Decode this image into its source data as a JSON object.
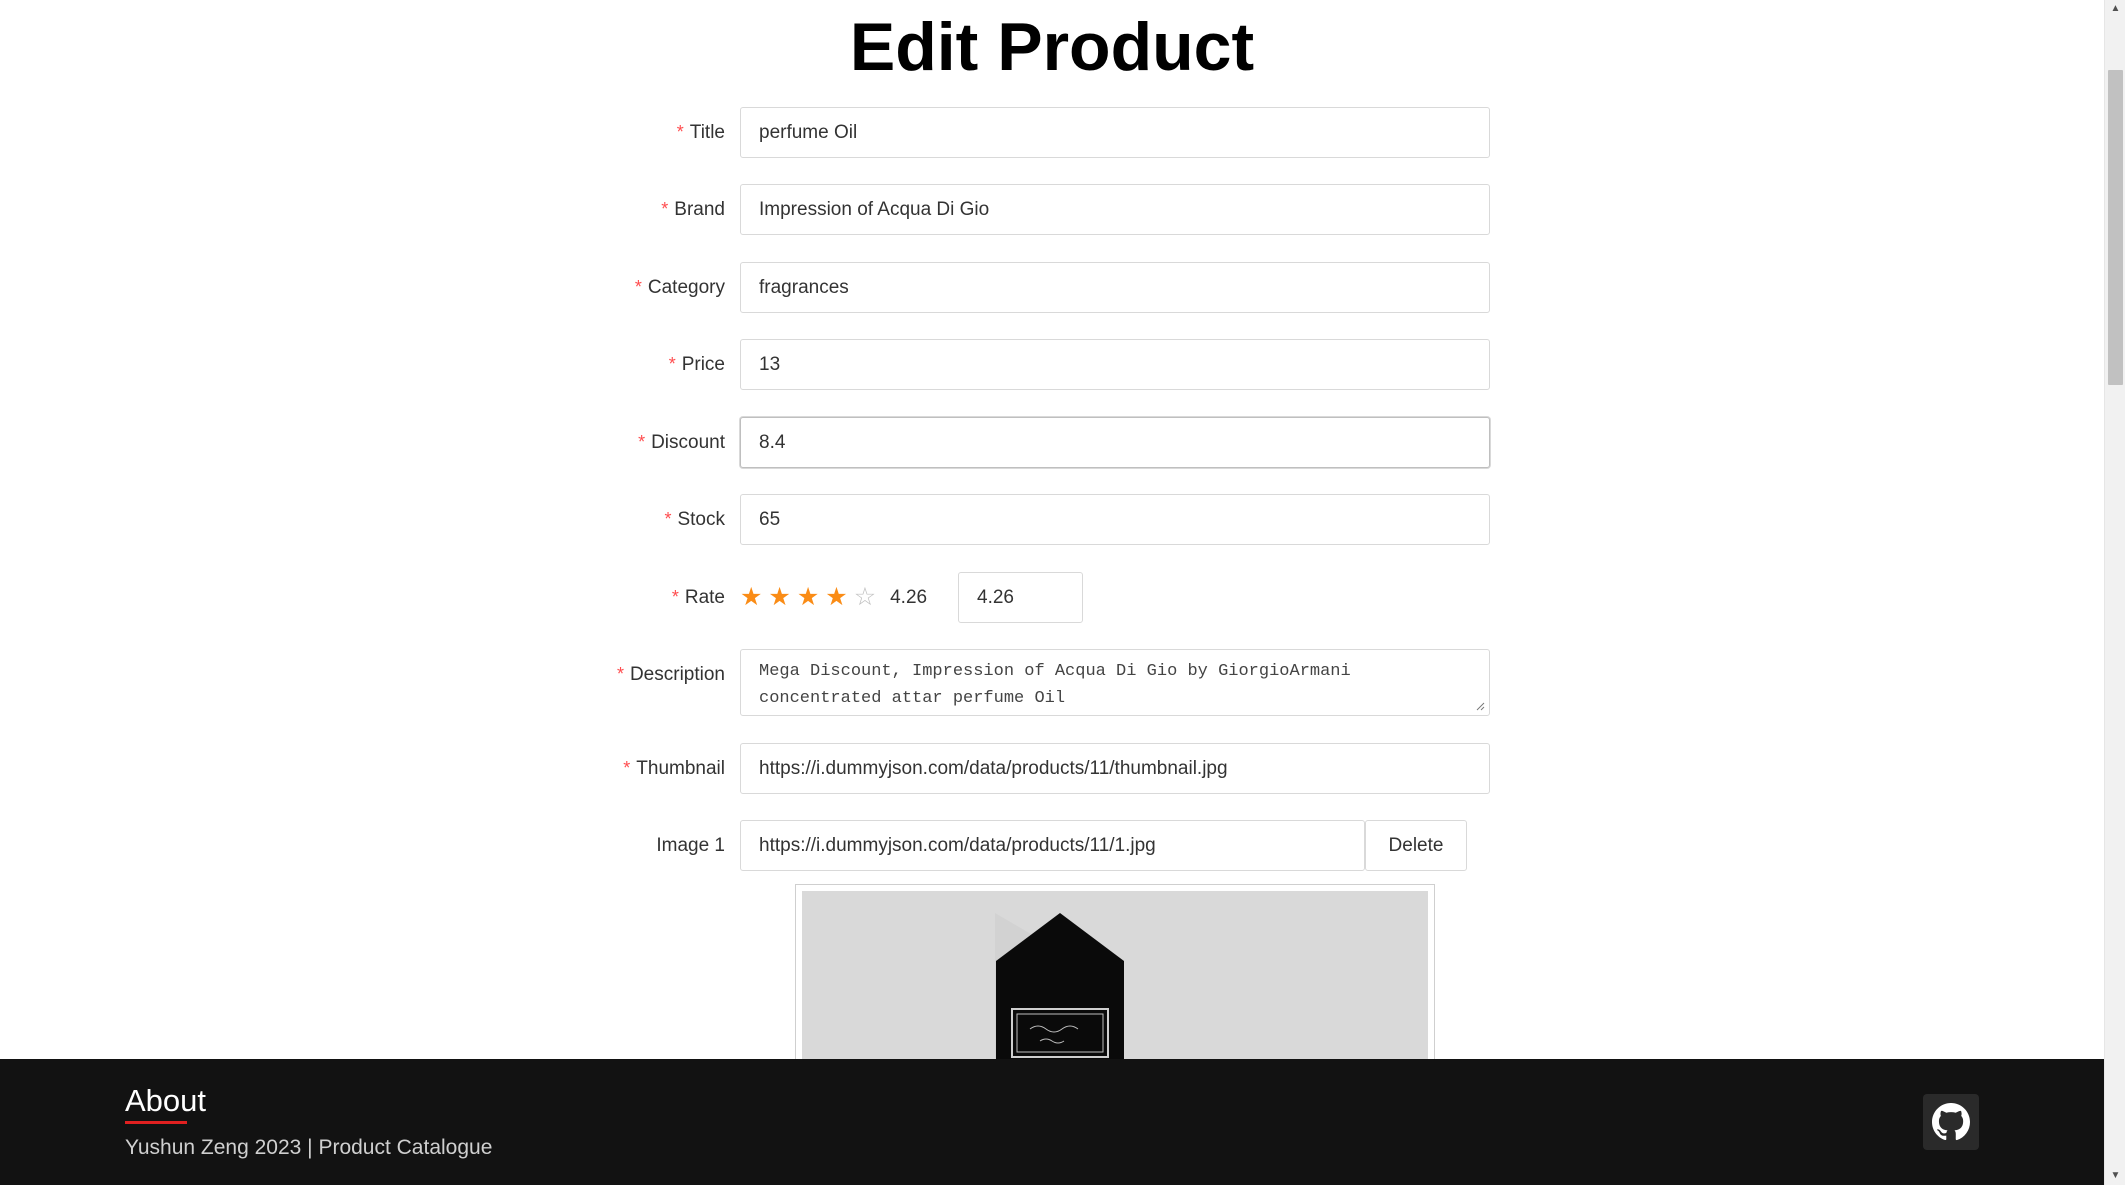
{
  "page": {
    "title": "Edit Product"
  },
  "form": {
    "title": {
      "label": "Title",
      "value": "perfume Oil"
    },
    "brand": {
      "label": "Brand",
      "value": "Impression of Acqua Di Gio"
    },
    "category": {
      "label": "Category",
      "value": "fragrances"
    },
    "price": {
      "label": "Price",
      "value": "13"
    },
    "discount": {
      "label": "Discount",
      "value": "8.4"
    },
    "stock": {
      "label": "Stock",
      "value": "65"
    },
    "rate": {
      "label": "Rate",
      "stars_value": 4.26,
      "stars_text": "4.26",
      "input_value": "4.26",
      "max_stars": 5
    },
    "description": {
      "label": "Description",
      "value": "Mega Discount, Impression of Acqua Di Gio by GiorgioArmani concentrated attar perfume Oil"
    },
    "thumbnail": {
      "label": "Thumbnail",
      "value": "https://i.dummyjson.com/data/products/11/thumbnail.jpg"
    },
    "images": [
      {
        "label": "Image 1",
        "value": "https://i.dummyjson.com/data/products/11/1.jpg",
        "delete_label": "Delete"
      }
    ],
    "required_mark": "*"
  },
  "footer": {
    "title": "About",
    "text": "Yushun Zeng 2023 | Product Catalogue",
    "github_icon": "github-icon"
  },
  "colors": {
    "required": "#ff4d4f",
    "star_active": "#fa8c16",
    "footer_bg": "#121212",
    "footer_accent": "#e02020"
  }
}
